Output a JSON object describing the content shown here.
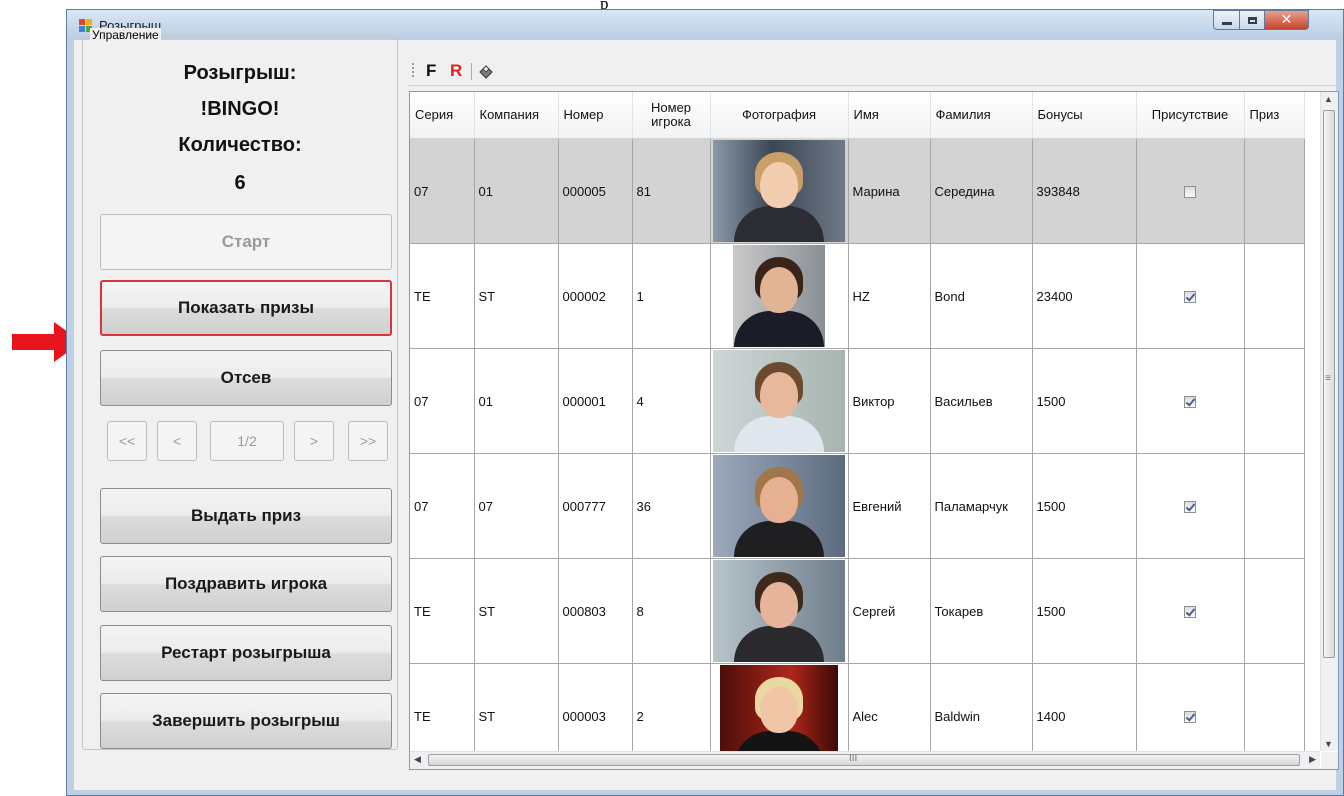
{
  "caption": "р",
  "window": {
    "title": "Розыгрыш",
    "close_glyph": "✕"
  },
  "colors": {
    "highlight_border": "#d9333b",
    "arrow": "#e8141c",
    "selected_row": "#d3d3d3",
    "tool_R": "#e02020"
  },
  "group": {
    "title": "Управление",
    "draw_label": "Розыгрыш:",
    "draw_name": "!BINGO!",
    "count_label": "Количество:",
    "count_value": "6"
  },
  "buttons": {
    "start": "Старт",
    "show_prizes": "Показать призы",
    "screening": "Отсев",
    "issue_prize": "Выдать приз",
    "congratulate": "Поздравить игрока",
    "restart": "Рестарт розыгрыша",
    "finish": "Завершить розыгрыш"
  },
  "pager": {
    "first": "<<",
    "prev": "<",
    "page": "1/2",
    "next": ">",
    "last": ">>"
  },
  "toolbar": {
    "f_label": "F",
    "r_label": "R",
    "tool_icon": "eraser-icon"
  },
  "grid": {
    "columns": [
      "Серия",
      "Компания",
      "Номер",
      "Номер игрока",
      "Фотография",
      "Имя",
      "Фамилия",
      "Бонусы",
      "Присутствие",
      "Приз"
    ],
    "rows": [
      {
        "series": "07",
        "company": "01",
        "number": "000005",
        "player_no": "81",
        "first_name": "Марина",
        "last_name": "Середина",
        "bonus": "393848",
        "present": false,
        "prize": ""
      },
      {
        "series": "TE",
        "company": "ST",
        "number": "000002",
        "player_no": "1",
        "first_name": "HZ",
        "last_name": "Bond",
        "bonus": "23400",
        "present": true,
        "prize": ""
      },
      {
        "series": "07",
        "company": "01",
        "number": "000001",
        "player_no": "4",
        "first_name": "Виктор",
        "last_name": "Васильев",
        "bonus": "1500",
        "present": true,
        "prize": ""
      },
      {
        "series": "07",
        "company": "07",
        "number": "000777",
        "player_no": "36",
        "first_name": "Евгений",
        "last_name": "Паламарчук",
        "bonus": "1500",
        "present": true,
        "prize": ""
      },
      {
        "series": "TE",
        "company": "ST",
        "number": "000803",
        "player_no": "8",
        "first_name": "Сергей",
        "last_name": "Токарев",
        "bonus": "1500",
        "present": true,
        "prize": ""
      },
      {
        "series": "TE",
        "company": "ST",
        "number": "000003",
        "player_no": "2",
        "first_name": "Alec",
        "last_name": "Baldwin",
        "bonus": "1400",
        "present": true,
        "prize": ""
      }
    ],
    "hscroll_glyph": "III",
    "vscroll_glyph": "≡"
  }
}
